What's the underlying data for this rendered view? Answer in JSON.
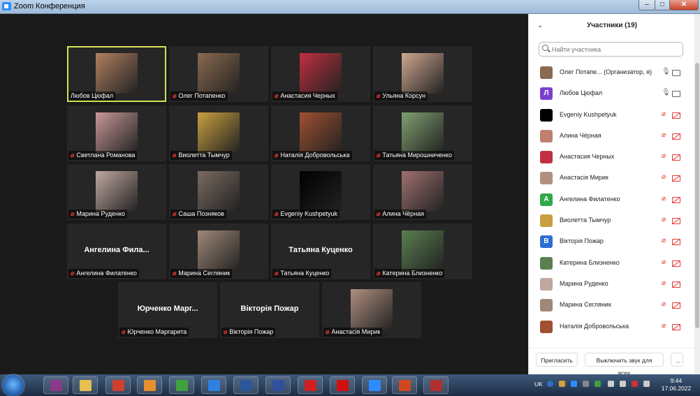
{
  "window": {
    "title": "Zoom Конференция",
    "min": "–",
    "max": "□",
    "close": "✕"
  },
  "tiles": [
    {
      "name": "Любов Цюфал",
      "muted": false,
      "photo": "#b08060"
    },
    {
      "name": "Олег Потапенко",
      "muted": true,
      "photo": "#8a6a50"
    },
    {
      "name": "Анастасия Черных",
      "muted": true,
      "photo": "#c03040"
    },
    {
      "name": "Ульяна Корсун",
      "muted": true,
      "photo": "#d0a890"
    },
    {
      "name": "Светлана Романова",
      "muted": true,
      "photo": "#c89898"
    },
    {
      "name": "Виолетта Тымчур",
      "muted": true,
      "photo": "#c8a040"
    },
    {
      "name": "Наталія Добровольська",
      "muted": true,
      "photo": "#a05030"
    },
    {
      "name": "Татьяна Мирошниченко",
      "muted": true,
      "photo": "#80a070"
    },
    {
      "name": "Марина Руденко",
      "muted": true,
      "photo": "#c0a8a0"
    },
    {
      "name": "Саша Позняков",
      "muted": true,
      "photo": "#7a6a60"
    },
    {
      "name": "Evgeniy Kushpetyuk",
      "muted": true,
      "photo": "#000000"
    },
    {
      "name": "Алина Чёрная",
      "muted": true,
      "photo": "#a07070"
    },
    {
      "name": "Ангелина Филатенко",
      "muted": true,
      "big": "Ангелина  Фила..."
    },
    {
      "name": "Марина Сегляник",
      "muted": true,
      "photo": "#a08878"
    },
    {
      "name": "Татьяна Куценко",
      "muted": true,
      "big": "Татьяна Куценко"
    },
    {
      "name": "Катерина Близненко",
      "muted": true,
      "photo": "#5a8050"
    },
    {
      "name": "Юрченко Маргарита",
      "muted": true,
      "big": "Юрченко  Марг..."
    },
    {
      "name": "Вікторія Пожар",
      "muted": true,
      "big": "Вікторія Пожар"
    },
    {
      "name": "Анастасія Мирик",
      "muted": true,
      "photo": "#b09080"
    }
  ],
  "panel": {
    "title": "Участники (19)",
    "collapse": "⌄",
    "search_placeholder": "Найти участника",
    "participants": [
      {
        "name": "Олег Потапе...  (Организатор, я)",
        "avatar_color": "#8a6a50",
        "letter": "",
        "mic_on": true,
        "cam_on": true
      },
      {
        "name": "Любов Цюфал",
        "avatar_color": "#7b3fd0",
        "letter": "Л",
        "mic_on": true,
        "cam_on": true
      },
      {
        "name": "Evgeniy Kushpetyuk",
        "avatar_color": "#000000",
        "letter": "",
        "mic_on": false,
        "cam_on": false
      },
      {
        "name": "Алина Чёрная",
        "avatar_color": "#c08070",
        "letter": "",
        "mic_on": false,
        "cam_on": false
      },
      {
        "name": "Анастасия Черных",
        "avatar_color": "#c03040",
        "letter": "",
        "mic_on": false,
        "cam_on": false
      },
      {
        "name": "Анастасія Мирик",
        "avatar_color": "#b09080",
        "letter": "",
        "mic_on": false,
        "cam_on": false
      },
      {
        "name": "Ангелина Филатенко",
        "avatar_color": "#2eaa4a",
        "letter": "А",
        "mic_on": false,
        "cam_on": false
      },
      {
        "name": "Виолетта Тымчур",
        "avatar_color": "#c8a040",
        "letter": "",
        "mic_on": false,
        "cam_on": false
      },
      {
        "name": "Вікторія Пожар",
        "avatar_color": "#2d6fd0",
        "letter": "В",
        "mic_on": false,
        "cam_on": false
      },
      {
        "name": "Катерина Близненко",
        "avatar_color": "#5a8050",
        "letter": "",
        "mic_on": false,
        "cam_on": false
      },
      {
        "name": "Марина Руденко",
        "avatar_color": "#c0a8a0",
        "letter": "",
        "mic_on": false,
        "cam_on": false
      },
      {
        "name": "Марина Сегляник",
        "avatar_color": "#a08878",
        "letter": "",
        "mic_on": false,
        "cam_on": false
      },
      {
        "name": "Наталія Добровольська",
        "avatar_color": "#a05030",
        "letter": "",
        "mic_on": false,
        "cam_on": false
      }
    ],
    "invite": "Пригласить",
    "mute_all": "Выключить звук для всех",
    "more": "..."
  },
  "taskbar": {
    "lang": "UK",
    "time": "9:44",
    "date": "17.06.2022",
    "apps": [
      {
        "icon": "winrar-icon",
        "color": "#8b3a8b"
      },
      {
        "icon": "explorer-icon",
        "color": "#e8c050"
      },
      {
        "icon": "settings-icon",
        "color": "#d04030"
      },
      {
        "icon": "media-player-icon",
        "color": "#e89030"
      },
      {
        "icon": "chrome-icon",
        "color": "#40a040"
      },
      {
        "icon": "ie-icon",
        "color": "#3080e0"
      },
      {
        "icon": "word-icon",
        "color": "#2b579a"
      },
      {
        "icon": "save-icon",
        "color": "#3050a0"
      },
      {
        "icon": "screen-recorder-icon",
        "color": "#d02020"
      },
      {
        "icon": "opera-icon",
        "color": "#d01010"
      },
      {
        "icon": "zoom-icon",
        "color": "#2d8cff"
      },
      {
        "icon": "powerpoint-icon",
        "color": "#d04820"
      },
      {
        "icon": "pdf-icon",
        "color": "#b03030"
      }
    ]
  }
}
